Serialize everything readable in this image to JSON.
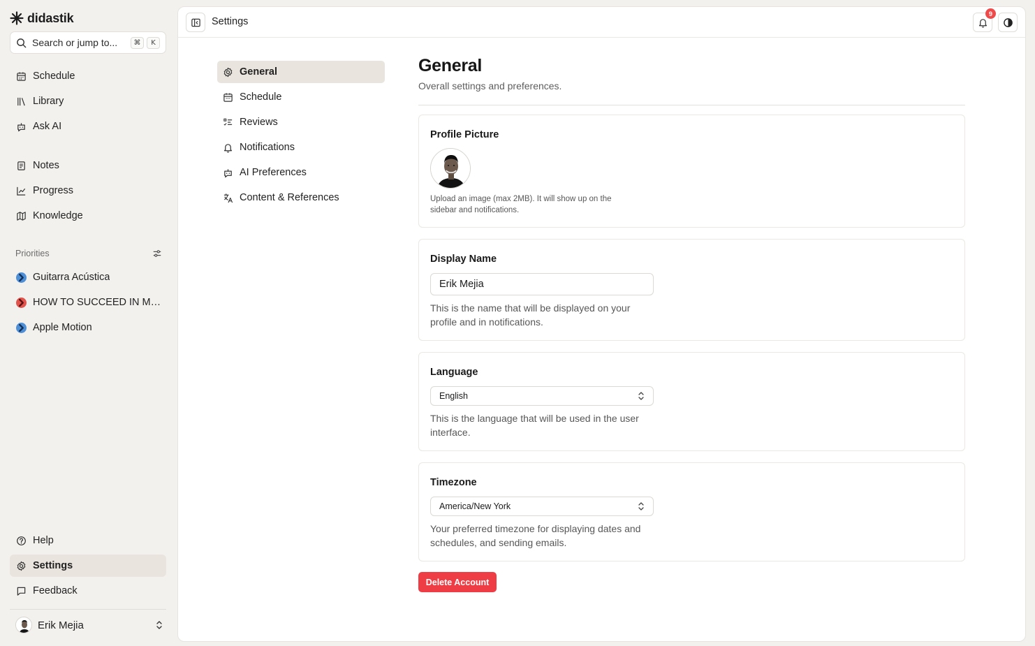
{
  "brand": {
    "name": "didastik"
  },
  "search": {
    "placeholder": "Search or jump to...",
    "shortcut": [
      "⌘",
      "K"
    ]
  },
  "sidebar": {
    "main_items": [
      {
        "label": "Schedule",
        "icon": "calendar-icon"
      },
      {
        "label": "Library",
        "icon": "library-icon"
      },
      {
        "label": "Ask AI",
        "icon": "bot-icon"
      }
    ],
    "secondary_items": [
      {
        "label": "Notes",
        "icon": "notes-icon"
      },
      {
        "label": "Progress",
        "icon": "chart-icon"
      },
      {
        "label": "Knowledge",
        "icon": "map-icon"
      }
    ],
    "priorities_label": "Priorities",
    "priorities": [
      {
        "label": "Guitarra Acústica",
        "color": "#4f8fd6"
      },
      {
        "label": "HOW TO SUCCEED IN MRBEAST PRODUCTION",
        "color": "#e2534c"
      },
      {
        "label": "Apple Motion",
        "color": "#4f8fd6"
      }
    ],
    "bottom_items": [
      {
        "label": "Help",
        "icon": "help-icon"
      },
      {
        "label": "Settings",
        "icon": "gear-icon",
        "active": true
      },
      {
        "label": "Feedback",
        "icon": "message-icon"
      }
    ],
    "user": {
      "name": "Erik Mejia"
    }
  },
  "topbar": {
    "title": "Settings",
    "notification_count": "9"
  },
  "settings_nav": [
    {
      "label": "General",
      "icon": "gear-icon",
      "active": true
    },
    {
      "label": "Schedule",
      "icon": "calendar-icon"
    },
    {
      "label": "Reviews",
      "icon": "list-checks-icon"
    },
    {
      "label": "Notifications",
      "icon": "bell-icon"
    },
    {
      "label": "AI Preferences",
      "icon": "bot-icon"
    },
    {
      "label": "Content & References",
      "icon": "languages-icon"
    }
  ],
  "general": {
    "title": "General",
    "subtitle": "Overall settings and preferences.",
    "profile_picture": {
      "title": "Profile Picture",
      "help": "Upload an image (max 2MB). It will show up on the sidebar and notifications."
    },
    "display_name": {
      "title": "Display Name",
      "value": "Erik Mejia",
      "help": "This is the name that will be displayed on your profile and in notifications."
    },
    "language": {
      "title": "Language",
      "value": "English",
      "help": "This is the language that will be used in the user interface."
    },
    "timezone": {
      "title": "Timezone",
      "value": "America/New York",
      "help": "Your preferred timezone for displaying dates and schedules, and sending emails."
    },
    "delete_label": "Delete Account"
  },
  "colors": {
    "accent_bg": "#e9e4dd",
    "danger": "#ee3d44",
    "badge": "#ef4a4a"
  }
}
